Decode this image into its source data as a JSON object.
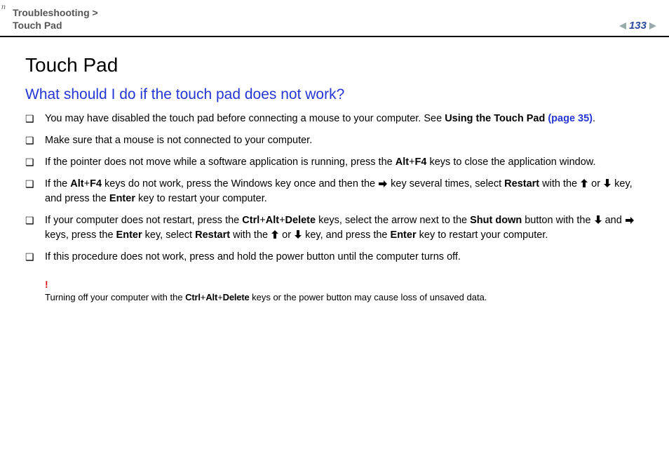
{
  "header": {
    "breadcrumb_line1": "Troubleshooting",
    "breadcrumb_sep": ">",
    "breadcrumb_line2": "Touch Pad",
    "page_number": "133",
    "n_label": "n"
  },
  "title": "Touch Pad",
  "question": "What should I do if the touch pad does not work?",
  "items": {
    "i1": {
      "a": "You may have disabled the touch pad before connecting a mouse to your computer. See ",
      "b": "Using the Touch Pad ",
      "link": "(page 35)",
      "c": "."
    },
    "i2": "Make sure that a mouse is not connected to your computer.",
    "i3": {
      "a": "If the pointer does not move while a software application is running, press the ",
      "b": "Alt",
      "plus": "+",
      "c": "F4",
      "d": " keys to close the application window."
    },
    "i4": {
      "a": "If the ",
      "b": "Alt",
      "plus": "+",
      "c": "F4",
      "d": " keys do not work, press the Windows key once and then the ",
      "e": " key several times, select ",
      "f": "Restart",
      "g": " with the ",
      "h": " or ",
      "i": " key, and press the ",
      "j": "Enter",
      "k": " key to restart your computer."
    },
    "i5": {
      "a": "If your computer does not restart, press the ",
      "b": "Ctrl",
      "plus": "+",
      "c": "Alt",
      "d": "Delete",
      "e": " keys, select the arrow next to the ",
      "f": "Shut down",
      "g": " button with the ",
      "h": " and ",
      "i": " keys, press the ",
      "j": "Enter",
      "k": " key, select ",
      "l": "Restart",
      "m": " with the ",
      "n": " or ",
      "o": " key, and press the ",
      "p": "Enter",
      "q": " key to restart your computer."
    },
    "i6": "If this procedure does not work, press and hold the power button until the computer turns off."
  },
  "warning": {
    "mark": "!",
    "a": "Turning off your computer with the ",
    "b": "Ctrl",
    "plus": "+",
    "c": "Alt",
    "d": "Delete",
    "e": " keys or the power button may cause loss of unsaved data."
  },
  "icons": {
    "right": "→",
    "up": "↑",
    "down": "↓"
  }
}
